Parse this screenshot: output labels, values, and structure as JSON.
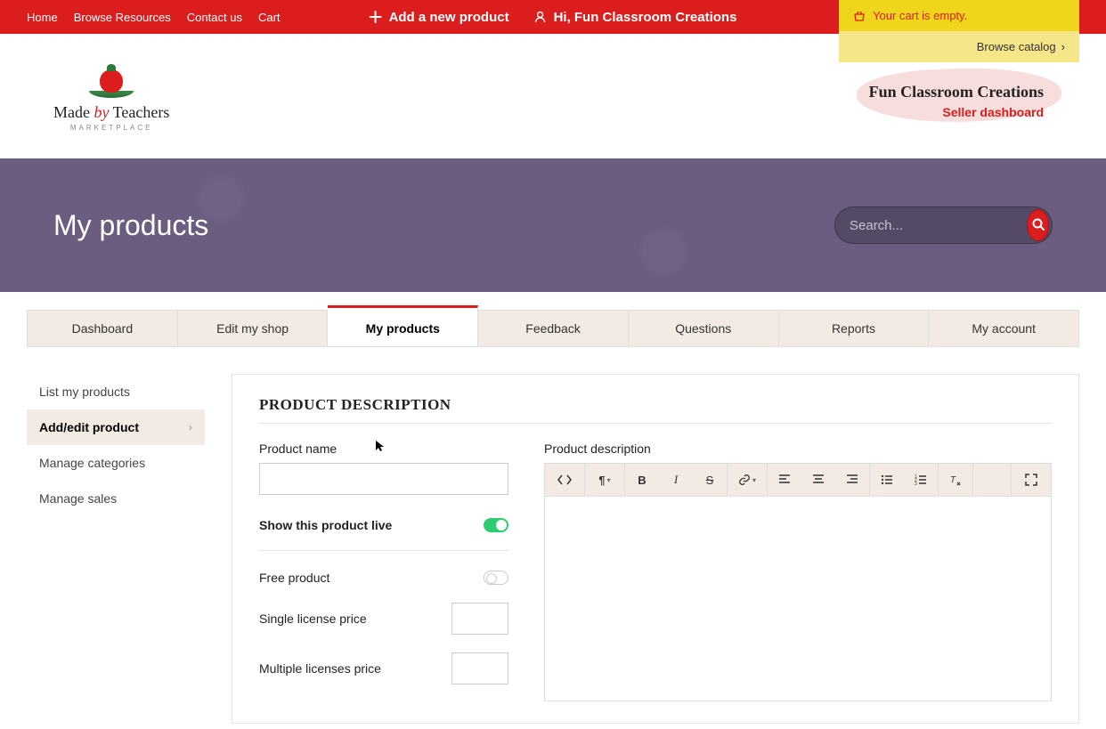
{
  "topnav": {
    "home": "Home",
    "browse": "Browse Resources",
    "contact": "Contact us",
    "cart": "Cart"
  },
  "topcenter": {
    "add_product": "Add a new product",
    "greeting": "Hi, Fun Classroom Creations"
  },
  "cartbox": {
    "empty": "Your cart is empty.",
    "browse": "Browse catalog"
  },
  "logo": {
    "line1_a": "Made ",
    "line1_b": "by",
    "line1_c": " Teachers",
    "sub": "MARKETPLACE"
  },
  "dashboard_badge": {
    "line1": "Fun Classroom Creations",
    "line2": "Seller dashboard"
  },
  "banner": {
    "title": "My products",
    "search_placeholder": "Search..."
  },
  "tabs": {
    "dashboard": "Dashboard",
    "edit_shop": "Edit my shop",
    "my_products": "My products",
    "feedback": "Feedback",
    "questions": "Questions",
    "reports": "Reports",
    "account": "My account"
  },
  "sidemenu": {
    "list": "List my products",
    "addedit": "Add/edit product",
    "categories": "Manage categories",
    "sales": "Manage sales"
  },
  "form": {
    "section_title": "PRODUCT DESCRIPTION",
    "product_name_label": "Product name",
    "product_name_value": "",
    "show_live_label": "Show this product live",
    "free_product_label": "Free product",
    "single_price_label": "Single license price",
    "single_price_value": "",
    "multi_price_label": "Multiple licenses price",
    "multi_price_value": "",
    "description_label": "Product description"
  },
  "toggles": {
    "show_live": true,
    "free_product": false
  }
}
